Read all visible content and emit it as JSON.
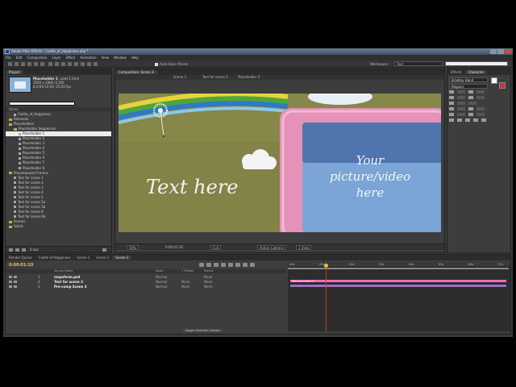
{
  "window": {
    "title": "Adobe After Effects - Castle_of_Happiness.aep *",
    "menu": [
      "File",
      "Edit",
      "Composition",
      "Layer",
      "Effect",
      "Animation",
      "View",
      "Window",
      "Help"
    ]
  },
  "toolbar": {
    "auto_open_label": "Auto-Open Panels",
    "workspace_label": "Workspace:",
    "workspace_value": "Text"
  },
  "project": {
    "tab": "Project",
    "item_name": "Placeholder 1",
    "item_used": ", used 1 time",
    "item_size": "1920 x 1080 (1.00)",
    "item_duration": "Δ 0:00:10:00, 25.00 fps",
    "col_name": "Name",
    "items": [
      {
        "label": "Castle_of_Happiness",
        "indent": 1,
        "kind": "file"
      },
      {
        "label": "Elements",
        "indent": 0,
        "kind": "folder"
      },
      {
        "label": "Placeholders",
        "indent": 0,
        "kind": "folder"
      },
      {
        "label": "Placeholder Sequences",
        "indent": 1,
        "kind": "folder"
      },
      {
        "label": "Placeholder 1",
        "indent": 2,
        "kind": "comp",
        "selected": true
      },
      {
        "label": "Placeholder 2",
        "indent": 2,
        "kind": "comp"
      },
      {
        "label": "Placeholder 3",
        "indent": 2,
        "kind": "comp"
      },
      {
        "label": "Placeholder 4",
        "indent": 2,
        "kind": "comp"
      },
      {
        "label": "Placeholder 5",
        "indent": 2,
        "kind": "comp"
      },
      {
        "label": "Placeholder 6",
        "indent": 2,
        "kind": "comp"
      },
      {
        "label": "Placeholder 7",
        "indent": 2,
        "kind": "comp"
      },
      {
        "label": "Placeholder 8",
        "indent": 2,
        "kind": "comp"
      },
      {
        "label": "Precomposed Frames",
        "indent": 0,
        "kind": "folder"
      },
      {
        "label": "Text for scene 1",
        "indent": 1,
        "kind": "comp"
      },
      {
        "label": "Text for scene 2",
        "indent": 1,
        "kind": "comp"
      },
      {
        "label": "Text for scene 3",
        "indent": 1,
        "kind": "comp"
      },
      {
        "label": "Text for scene 4",
        "indent": 1,
        "kind": "comp"
      },
      {
        "label": "Text for scene 5",
        "indent": 1,
        "kind": "comp"
      },
      {
        "label": "Text for scene 5a",
        "indent": 1,
        "kind": "comp"
      },
      {
        "label": "Text for scene 5b",
        "indent": 1,
        "kind": "comp"
      },
      {
        "label": "Text for scene 6",
        "indent": 1,
        "kind": "comp"
      },
      {
        "label": "Text for scene 6b",
        "indent": 1,
        "kind": "comp"
      },
      {
        "label": "Scenes",
        "indent": 0,
        "kind": "folder"
      },
      {
        "label": "Solids",
        "indent": 0,
        "kind": "folder"
      }
    ],
    "bpc": "8 bpc"
  },
  "composition": {
    "tab": "Composition: Scene 3",
    "subtabs": [
      "Scene 3",
      "Text for scene 3",
      "Placeholder 3"
    ],
    "canvas_text": "Text here",
    "placeholder_text": [
      "Your",
      "picture/video",
      "here"
    ],
    "zoom": "50%",
    "timecode": "0:00:01:10",
    "resolution": "Full",
    "camera": "Active Camera",
    "views": "1 View"
  },
  "right_panel": {
    "tabs": [
      "Effects",
      "Character"
    ],
    "font": "Bradley Hand",
    "style": "Regular"
  },
  "timeline": {
    "tabs": [
      "Render Queue",
      "Castle of Happiness",
      "Scene 1",
      "Scene 2",
      "Scene 3"
    ],
    "time": "0:00:01:10",
    "columns": [
      "Source Name",
      "Mode",
      "T TrkMat",
      "Parent"
    ],
    "layers": [
      {
        "index": "1",
        "name": "mapsform.psd",
        "mode": "Normal",
        "trkmat": "",
        "parent": "None"
      },
      {
        "index": "2",
        "name": "Text for scene 3",
        "mode": "Normal",
        "trkmat": "None",
        "parent": "None"
      },
      {
        "index": "3",
        "name": "Pre-comp Scene 3",
        "mode": "Normal",
        "trkmat": "None",
        "parent": "None"
      }
    ],
    "ruler": [
      "00s",
      "01s",
      "02s",
      "03s",
      "04s",
      "05s",
      "06s",
      "07s"
    ],
    "bar_label": "Text for scene 3",
    "toggle_label": "Toggle Switches / Modes",
    "colors": {
      "bar_pink": "#e96fb4",
      "bar_purple": "#9a6fc4",
      "time": "#f0c040"
    }
  }
}
